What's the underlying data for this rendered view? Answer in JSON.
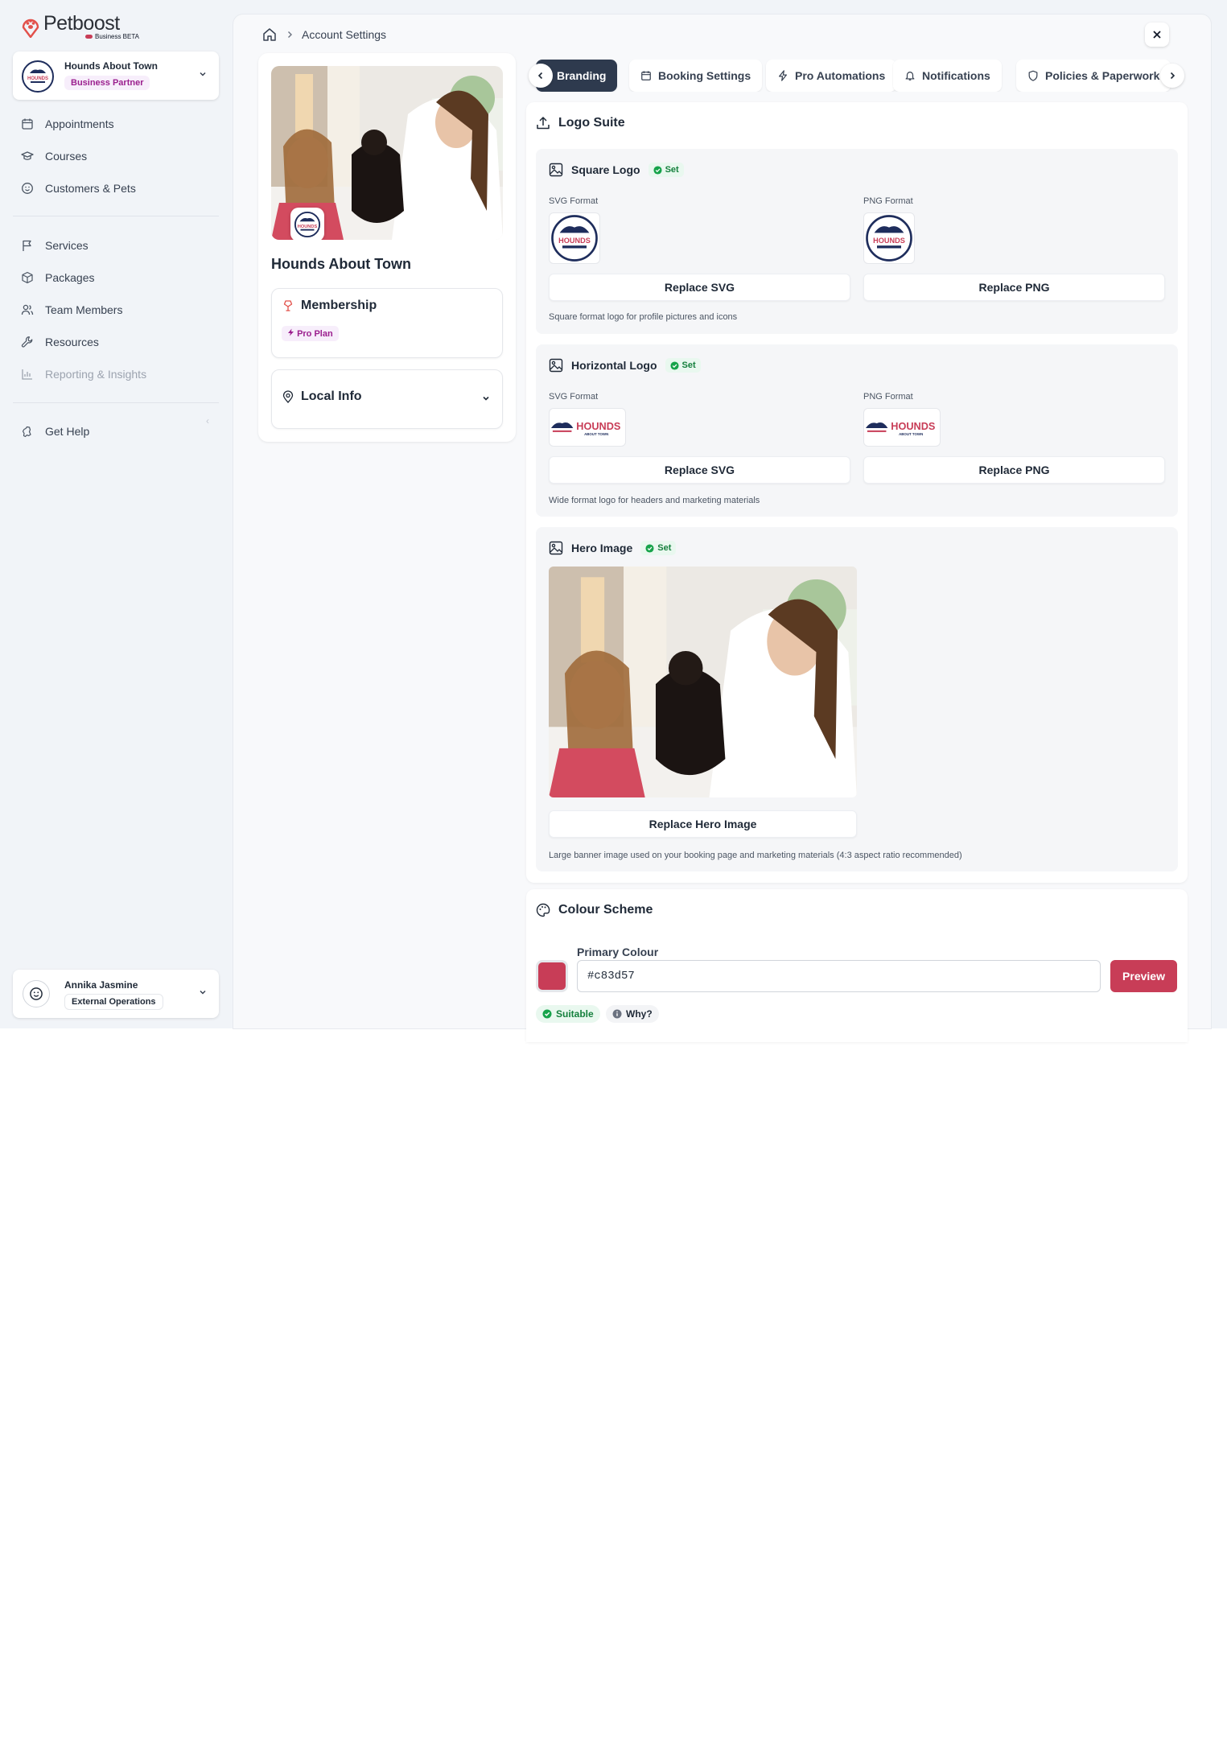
{
  "brand": {
    "name": "Petboost",
    "sub": "Business BETA",
    "accent": "#e2504a"
  },
  "business": {
    "name": "Hounds About Town",
    "badge": "Business Partner"
  },
  "nav": {
    "group1": [
      {
        "label": "Appointments",
        "icon": "calendar-icon"
      },
      {
        "label": "Courses",
        "icon": "graduation-cap-icon"
      },
      {
        "label": "Customers & Pets",
        "icon": "smile-icon"
      }
    ],
    "group2": [
      {
        "label": "Services",
        "icon": "flag-icon"
      },
      {
        "label": "Packages",
        "icon": "package-icon"
      },
      {
        "label": "Team Members",
        "icon": "users-icon"
      },
      {
        "label": "Resources",
        "icon": "wrench-icon"
      },
      {
        "label": "Reporting & Insights",
        "icon": "chart-icon"
      }
    ],
    "group3": [
      {
        "label": "Get Help",
        "icon": "life-buoy-icon"
      }
    ]
  },
  "user": {
    "name": "Annika Jasmine",
    "role": "External Operations"
  },
  "breadcrumb": {
    "current": "Account Settings"
  },
  "profile": {
    "name": "Hounds About Town",
    "membership_title": "Membership",
    "plan": "Pro Plan",
    "local_info_title": "Local Info"
  },
  "tabs": [
    "Branding",
    "Booking Settings",
    "Pro Automations",
    "Notifications",
    "Policies & Paperwork"
  ],
  "logo_suite": {
    "title": "Logo Suite",
    "set_label": "Set",
    "svg_format": "SVG Format",
    "png_format": "PNG Format",
    "square": {
      "title": "Square Logo",
      "replace_svg": "Replace SVG",
      "replace_png": "Replace PNG",
      "hint": "Square format logo for profile pictures and icons"
    },
    "horizontal": {
      "title": "Horizontal Logo",
      "replace_svg": "Replace SVG",
      "replace_png": "Replace PNG",
      "hint": "Wide format logo for headers and marketing materials",
      "wordmark": "HOUNDS",
      "wordmark_sub": "ABOUT TOWN"
    },
    "hero": {
      "title": "Hero Image",
      "replace": "Replace Hero Image",
      "hint": "Large banner image used on your booking page and marketing materials (4:3 aspect ratio recommended)"
    }
  },
  "colour": {
    "title": "Colour Scheme",
    "label": "Primary Colour",
    "value": "#c83d57",
    "preview": "Preview",
    "suitable": "Suitable",
    "why": "Why?"
  },
  "colors": {
    "primary": "#c83d57",
    "navy": "#1e2d5c",
    "tab_active": "#2e3a4e",
    "success": "#15803d"
  }
}
